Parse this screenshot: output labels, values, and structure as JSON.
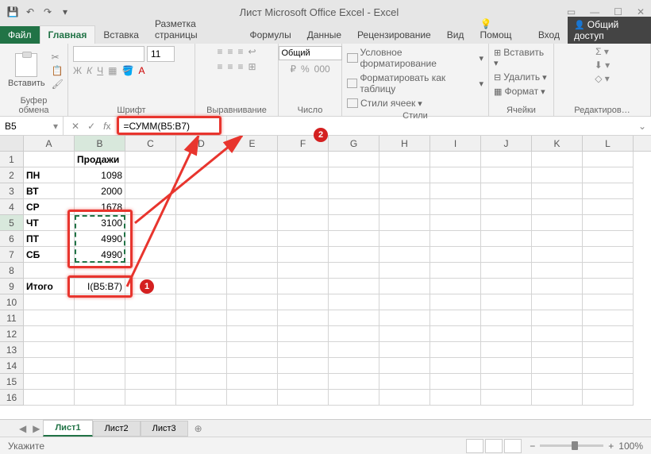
{
  "title": "Лист Microsoft Office Excel - Excel",
  "tabs": {
    "file": "Файл",
    "home": "Главная",
    "insert": "Вставка",
    "layout": "Разметка страницы",
    "formulas": "Формулы",
    "data": "Данные",
    "review": "Рецензирование",
    "view": "Вид",
    "help": "Помощ",
    "signin": "Вход",
    "share": "Общий доступ"
  },
  "ribbon": {
    "clipboard": {
      "paste": "Вставить",
      "label": "Буфер обмена"
    },
    "font": {
      "size": "11",
      "label": "Шрифт"
    },
    "align": {
      "label": "Выравнивание"
    },
    "number": {
      "format": "Общий",
      "label": "Число"
    },
    "styles": {
      "cond": "Условное форматирование",
      "table": "Форматировать как таблицу",
      "cell": "Стили ячеек",
      "label": "Стили"
    },
    "cells": {
      "insert": "Вставить",
      "delete": "Удалить",
      "format": "Формат",
      "label": "Ячейки"
    },
    "editing": {
      "label": "Редактиров…"
    }
  },
  "namebox": "B5",
  "formula": "=СУММ(B5:B7)",
  "cols": [
    "A",
    "B",
    "C",
    "D",
    "E",
    "F",
    "G",
    "H",
    "I",
    "J",
    "K",
    "L"
  ],
  "data": {
    "b1": "Продажи",
    "a2": "ПН",
    "b2": "1098",
    "a3": "ВТ",
    "b3": "2000",
    "a4": "СР",
    "b4": "1678",
    "a5": "ЧТ",
    "b5": "3100",
    "a6": "ПТ",
    "b6": "4990",
    "a7": "СБ",
    "b7": "4990",
    "a9": "Итого",
    "b9": "І(B5:B7)"
  },
  "sheets": {
    "s1": "Лист1",
    "s2": "Лист2",
    "s3": "Лист3"
  },
  "status": "Укажите",
  "zoom": "100%"
}
